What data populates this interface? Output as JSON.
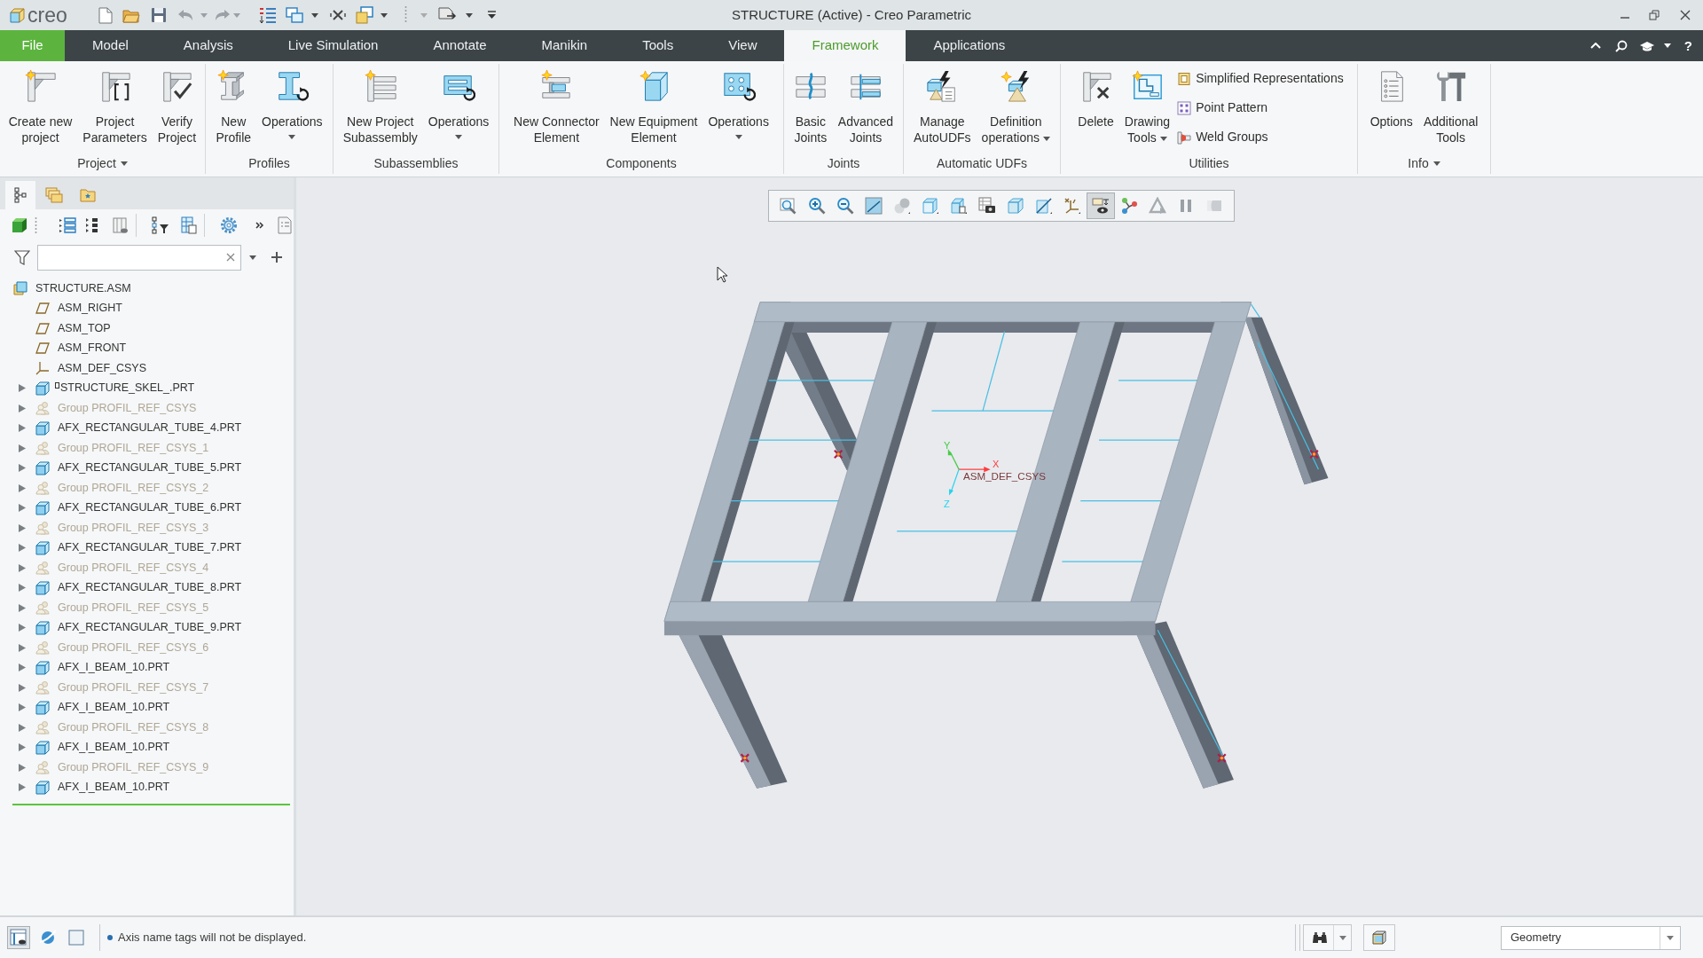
{
  "window": {
    "logo": "creo",
    "title": "STRUCTURE (Active) - Creo Parametric"
  },
  "ribbon_tabs": [
    {
      "label": "File",
      "kind": "file",
      "selected": false
    },
    {
      "label": "Model",
      "kind": "tab",
      "selected": false
    },
    {
      "label": "Analysis",
      "kind": "tab",
      "selected": false
    },
    {
      "label": "Live Simulation",
      "kind": "tab",
      "selected": false
    },
    {
      "label": "Annotate",
      "kind": "tab",
      "selected": false
    },
    {
      "label": "Manikin",
      "kind": "tab",
      "selected": false
    },
    {
      "label": "Tools",
      "kind": "tab",
      "selected": false
    },
    {
      "label": "View",
      "kind": "tab",
      "selected": false
    },
    {
      "label": "Framework",
      "kind": "tab",
      "selected": true
    },
    {
      "label": "Applications",
      "kind": "tab",
      "selected": false
    }
  ],
  "help_label": "?",
  "ribbon_groups": [
    {
      "label": "Project",
      "menu": true,
      "buttons": [
        {
          "lines": [
            "Create new",
            "project"
          ],
          "menu": false
        },
        {
          "lines": [
            "Project",
            "Parameters"
          ],
          "menu": false
        },
        {
          "lines": [
            "Verify",
            "Project"
          ],
          "menu": false
        }
      ]
    },
    {
      "label": "Profiles",
      "menu": false,
      "buttons": [
        {
          "lines": [
            "New",
            "Profile"
          ],
          "menu": false
        },
        {
          "lines": [
            "Operations"
          ],
          "menu": true
        }
      ]
    },
    {
      "label": "Subassemblies",
      "menu": false,
      "buttons": [
        {
          "lines": [
            "New Project",
            "Subassembly"
          ],
          "menu": false
        },
        {
          "lines": [
            "Operations"
          ],
          "menu": true
        }
      ]
    },
    {
      "label": "Components",
      "menu": false,
      "buttons": [
        {
          "lines": [
            "New Connector",
            "Element"
          ],
          "menu": false
        },
        {
          "lines": [
            "New Equipment",
            "Element"
          ],
          "menu": false
        },
        {
          "lines": [
            "Operations"
          ],
          "menu": true
        }
      ]
    },
    {
      "label": "Joints",
      "menu": false,
      "buttons": [
        {
          "lines": [
            "Basic",
            "Joints"
          ],
          "menu": false
        },
        {
          "lines": [
            "Advanced",
            "Joints"
          ],
          "menu": false
        }
      ]
    },
    {
      "label": "Automatic UDFs",
      "menu": false,
      "buttons": [
        {
          "lines": [
            "Manage",
            "AutoUDFs"
          ],
          "menu": false
        },
        {
          "lines": [
            "Definition",
            "operations"
          ],
          "menu": true
        }
      ]
    },
    {
      "label": "Utilities",
      "menu": false,
      "buttons": [
        {
          "lines": [
            "Delete"
          ],
          "menu": false
        },
        {
          "lines": [
            "Drawing",
            "Tools"
          ],
          "menu": true
        }
      ],
      "small_buttons": [
        {
          "label": "Simplified Representations"
        },
        {
          "label": "Point Pattern"
        },
        {
          "label": "Weld Groups"
        }
      ]
    },
    {
      "label": "Info",
      "menu": true,
      "buttons": [
        {
          "lines": [
            "Options"
          ],
          "menu": false
        },
        {
          "lines": [
            "Additional",
            "Tools"
          ],
          "menu": false
        }
      ]
    }
  ],
  "model_tree": {
    "panel_tabs": [
      {
        "selected": true
      },
      {
        "selected": false
      },
      {
        "selected": false
      }
    ],
    "root": {
      "label": "STRUCTURE.ASM",
      "kind": "assembly",
      "children": [
        {
          "label": "ASM_RIGHT",
          "kind": "plane"
        },
        {
          "label": "ASM_TOP",
          "kind": "plane"
        },
        {
          "label": "ASM_FRONT",
          "kind": "plane"
        },
        {
          "label": "ASM_DEF_CSYS",
          "kind": "csys"
        },
        {
          "label": "STRUCTURE_SKEL_.PRT",
          "kind": "skeleton",
          "expanded": false
        },
        {
          "label": "Group PROFIL_REF_CSYS",
          "kind": "group",
          "expanded": false
        },
        {
          "label": "AFX_RECTANGULAR_TUBE_4.PRT",
          "kind": "part",
          "expanded": false
        },
        {
          "label": "Group PROFIL_REF_CSYS_1",
          "kind": "group",
          "expanded": false
        },
        {
          "label": "AFX_RECTANGULAR_TUBE_5.PRT",
          "kind": "part",
          "expanded": false
        },
        {
          "label": "Group PROFIL_REF_CSYS_2",
          "kind": "group",
          "expanded": false
        },
        {
          "label": "AFX_RECTANGULAR_TUBE_6.PRT",
          "kind": "part",
          "expanded": false
        },
        {
          "label": "Group PROFIL_REF_CSYS_3",
          "kind": "group",
          "expanded": false
        },
        {
          "label": "AFX_RECTANGULAR_TUBE_7.PRT",
          "kind": "part",
          "expanded": false
        },
        {
          "label": "Group PROFIL_REF_CSYS_4",
          "kind": "group",
          "expanded": false
        },
        {
          "label": "AFX_RECTANGULAR_TUBE_8.PRT",
          "kind": "part",
          "expanded": false
        },
        {
          "label": "Group PROFIL_REF_CSYS_5",
          "kind": "group",
          "expanded": false
        },
        {
          "label": "AFX_RECTANGULAR_TUBE_9.PRT",
          "kind": "part",
          "expanded": false
        },
        {
          "label": "Group PROFIL_REF_CSYS_6",
          "kind": "group",
          "expanded": false
        },
        {
          "label": "AFX_I_BEAM_10.PRT",
          "kind": "part",
          "expanded": false
        },
        {
          "label": "Group PROFIL_REF_CSYS_7",
          "kind": "group",
          "expanded": false
        },
        {
          "label": "AFX_I_BEAM_10.PRT",
          "kind": "part",
          "expanded": false
        },
        {
          "label": "Group PROFIL_REF_CSYS_8",
          "kind": "group",
          "expanded": false
        },
        {
          "label": "AFX_I_BEAM_10.PRT",
          "kind": "part",
          "expanded": false
        },
        {
          "label": "Group PROFIL_REF_CSYS_9",
          "kind": "group",
          "expanded": false
        },
        {
          "label": "AFX_I_BEAM_10.PRT",
          "kind": "part",
          "expanded": false
        }
      ]
    }
  },
  "view_toolbar": [
    {
      "on": false
    },
    {
      "on": false
    },
    {
      "on": false
    },
    {
      "on": false
    },
    {
      "on": false
    },
    {
      "on": false
    },
    {
      "on": false
    },
    {
      "on": false
    },
    {
      "on": false
    },
    {
      "on": false
    },
    {
      "on": false
    },
    {
      "on": true
    },
    {
      "on": false
    },
    {
      "on": false
    },
    {
      "on": false
    },
    {
      "on": false
    }
  ],
  "viewport": {
    "csys_label": "ASM_DEF_CSYS",
    "axis_labels": [
      "X",
      "Y",
      "Z"
    ]
  },
  "status_bar": {
    "tools": [
      {
        "on": true
      },
      {
        "on": false
      },
      {
        "on": false
      }
    ],
    "message": "Axis name tags will not be displayed.",
    "filter": "Geometry"
  }
}
